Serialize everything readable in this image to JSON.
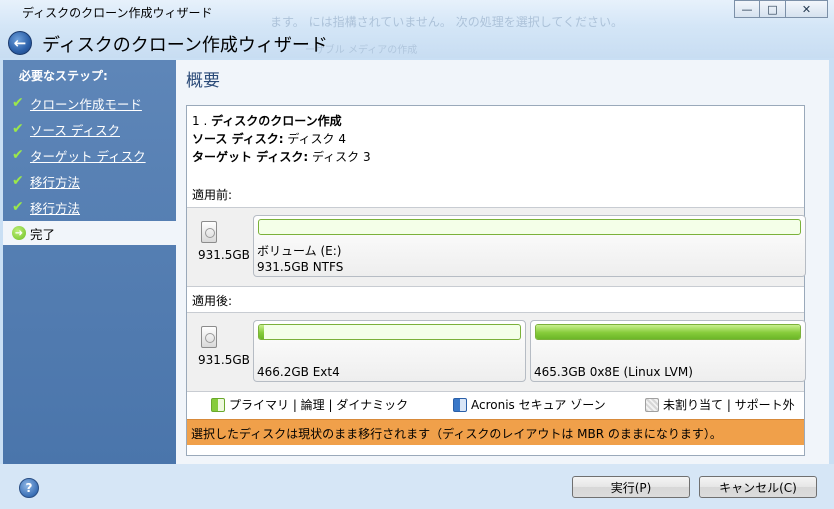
{
  "window": {
    "title": "ディスクのクローン作成ウィザード",
    "wizard_title": "ディスクのクローン作成ウィザード",
    "ghost_text_1": "ます。 には指構されていません。 次の処理を選択してください。",
    "ghost_text_2": "ーザブル メディアの作成",
    "controls": {
      "minimize": "—",
      "maximize": "□",
      "close": "✕"
    }
  },
  "sidebar": {
    "title": "必要なステップ:",
    "steps": [
      {
        "label": "クローン作成モード",
        "state": "done"
      },
      {
        "label": "ソース ディスク",
        "state": "done"
      },
      {
        "label": "ターゲット ディスク",
        "state": "done"
      },
      {
        "label": "移行方法",
        "state": "done"
      },
      {
        "label": "移行方法",
        "state": "done"
      },
      {
        "label": "完了",
        "state": "current"
      }
    ]
  },
  "main": {
    "page_title": "概要",
    "summary": {
      "op_number": "1",
      "op_title": "ディスクのクローン作成",
      "source_label": "ソース ディスク:",
      "source_value": "ディスク 4",
      "target_label": "ターゲット ディスク:",
      "target_value": "ディスク 3"
    },
    "before": {
      "label": "適用前:",
      "disk_size": "931.5GB",
      "partitions": [
        {
          "name": "ボリューム (E:)",
          "info": "931.5GB  NTFS",
          "used_fraction": 0.0
        }
      ]
    },
    "after": {
      "label": "適用後:",
      "disk_size": "931.5GB",
      "partitions": [
        {
          "name": "",
          "info": "466.2GB  Ext4",
          "used_fraction": 0.02
        },
        {
          "name": "",
          "info": "465.3GB  0x8E (Linux LVM)",
          "used_fraction": 1.0
        }
      ]
    },
    "legend": {
      "primary": "プライマリ | 論理 | ダイナミック",
      "secure_zone": "Acronis セキュア ゾーン",
      "unallocated": "未割り当て | サポート外"
    },
    "warning": "選択したディスクは現状のまま移行されます（ディスクのレイアウトは MBR のままになります）。"
  },
  "footer": {
    "help": "?",
    "run_label": "実行(P)",
    "cancel_label": "キャンセル(C)"
  },
  "colors": {
    "sidebar_bg": "#4f79ae",
    "accent_green": "#86cc3a",
    "warning_bg": "#f0a04a",
    "title_blue": "#2a4a78"
  }
}
